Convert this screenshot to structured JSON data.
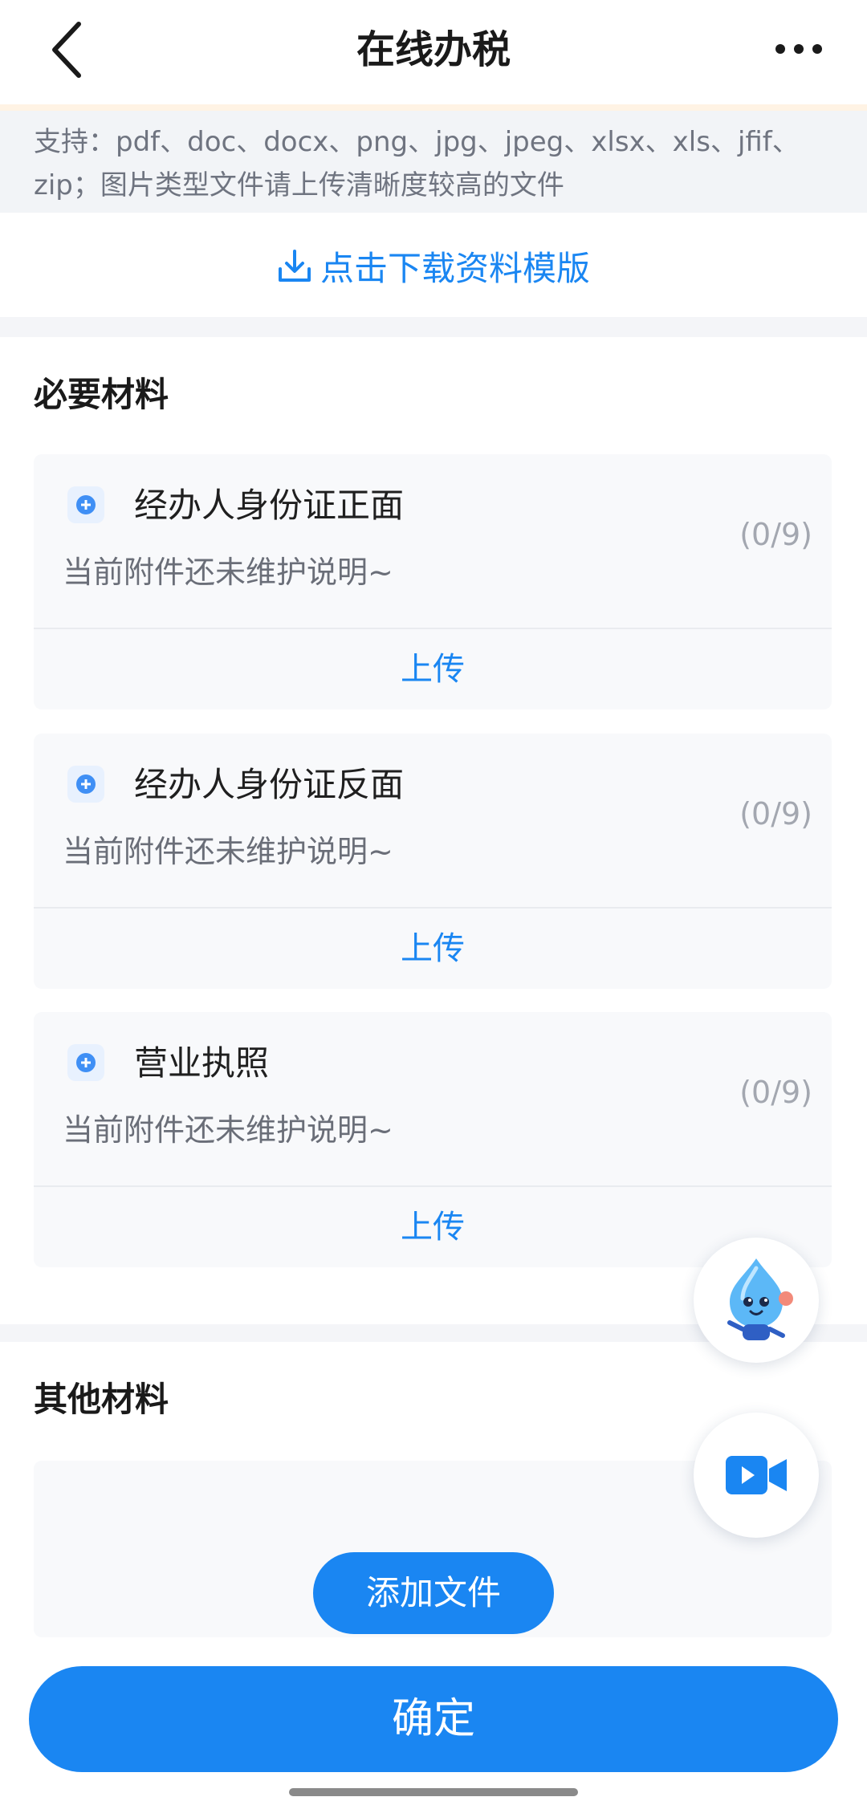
{
  "header": {
    "title": "在线办税",
    "back_icon": "chevron-left-icon",
    "more_icon": "more-dots-icon"
  },
  "notice": {
    "text": "支持：pdf、doc、docx、png、jpg、jpeg、xlsx、xls、jfif、zip；图片类型文件请上传清晰度较高的文件"
  },
  "download": {
    "icon": "download-icon",
    "label": "点击下载资料模版"
  },
  "required": {
    "title": "必要材料",
    "items": [
      {
        "label": "经办人身份证正面",
        "count": "(0/9)",
        "desc": "当前附件还未维护说明~",
        "upload_label": "上传"
      },
      {
        "label": "经办人身份证反面",
        "count": "(0/9)",
        "desc": "当前附件还未维护说明~",
        "upload_label": "上传"
      },
      {
        "label": "营业执照",
        "count": "(0/9)",
        "desc": "当前附件还未维护说明~",
        "upload_label": "上传"
      }
    ]
  },
  "other": {
    "title": "其他材料",
    "add_file_label": "添加文件"
  },
  "floating": {
    "assistant_icon": "assistant-mascot-icon",
    "video_icon": "video-camera-icon"
  },
  "confirm_label": "确定",
  "colors": {
    "accent": "#1a86f2",
    "background": "#f4f5f8",
    "notice_bg": "#f2f4f7"
  }
}
